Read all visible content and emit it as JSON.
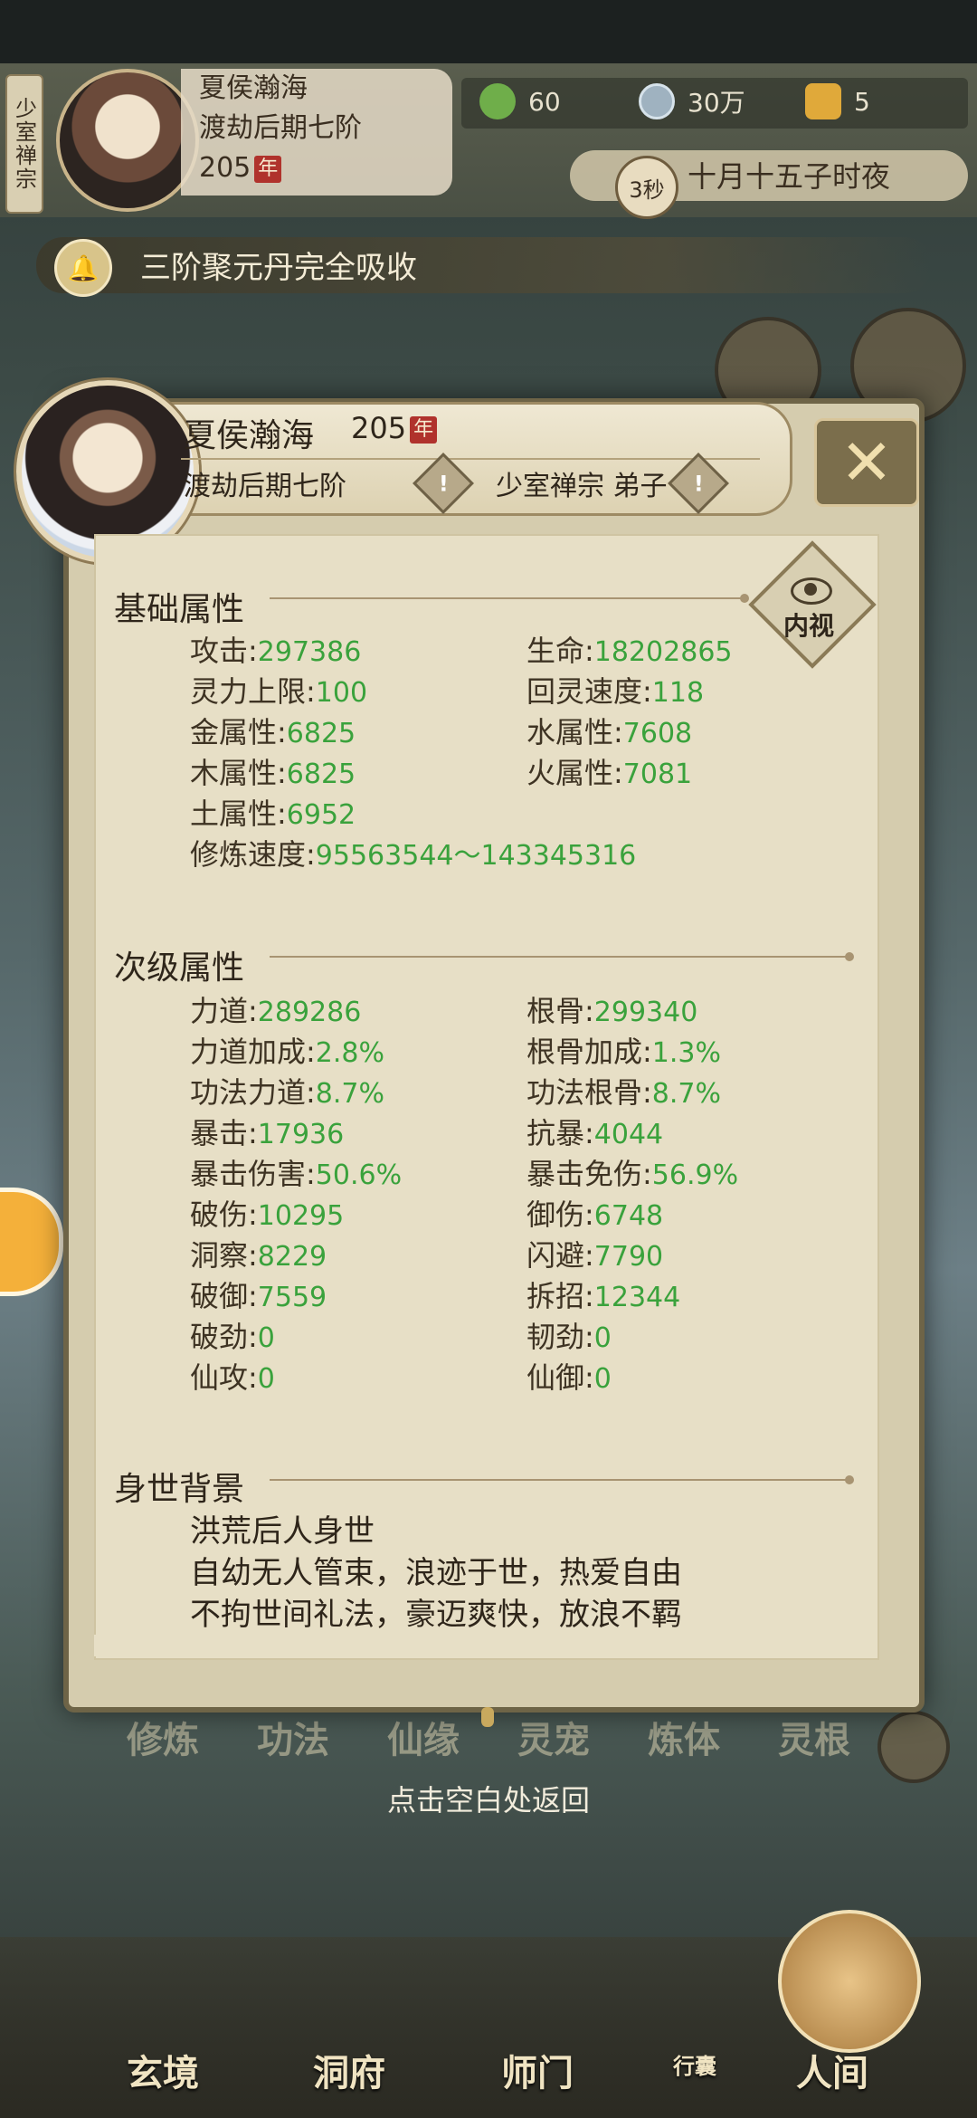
{
  "hud": {
    "sect_tag": "少室禅宗",
    "name": "夏侯瀚海",
    "realm": "渡劫后期七阶",
    "age": "205",
    "age_unit": "年",
    "resources": [
      {
        "icon": "leaf-icon",
        "value": "60"
      },
      {
        "icon": "coin-icon",
        "value": "30万"
      },
      {
        "icon": "trophy-icon",
        "value": "5"
      }
    ],
    "timer": "3秒",
    "time_text": "十月十五子时夜",
    "notice": "三阶聚元丹完全吸收"
  },
  "header": {
    "name": "夏侯瀚海",
    "age": "205",
    "age_unit": "年",
    "realm": "渡劫后期七阶",
    "sect": "少室禅宗 弟子"
  },
  "inner_view_label": "内视",
  "basic": {
    "title": "基础属性",
    "left": [
      {
        "label": "攻击",
        "value": "297386"
      },
      {
        "label": "灵力上限",
        "value": "100"
      },
      {
        "label": "金属性",
        "value": "6825"
      },
      {
        "label": "木属性",
        "value": "6825"
      },
      {
        "label": "土属性",
        "value": "6952"
      },
      {
        "label": "修炼速度",
        "value": "95563544～143345316"
      }
    ],
    "right": [
      {
        "label": "生命",
        "value": "18202865"
      },
      {
        "label": "回灵速度",
        "value": "118"
      },
      {
        "label": "水属性",
        "value": "7608"
      },
      {
        "label": "火属性",
        "value": "7081"
      }
    ]
  },
  "secondary": {
    "title": "次级属性",
    "left": [
      {
        "label": "力道",
        "value": "289286"
      },
      {
        "label": "力道加成",
        "value": "2.8%"
      },
      {
        "label": "功法力道",
        "value": "8.7%"
      },
      {
        "label": "暴击",
        "value": "17936"
      },
      {
        "label": "暴击伤害",
        "value": "50.6%"
      },
      {
        "label": "破伤",
        "value": "10295"
      },
      {
        "label": "洞察",
        "value": "8229"
      },
      {
        "label": "破御",
        "value": "7559"
      },
      {
        "label": "破劲",
        "value": "0"
      },
      {
        "label": "仙攻",
        "value": "0"
      }
    ],
    "right": [
      {
        "label": "根骨",
        "value": "299340"
      },
      {
        "label": "根骨加成",
        "value": "1.3%"
      },
      {
        "label": "功法根骨",
        "value": "8.7%"
      },
      {
        "label": "抗暴",
        "value": "4044"
      },
      {
        "label": "暴击免伤",
        "value": "56.9%"
      },
      {
        "label": "御伤",
        "value": "6748"
      },
      {
        "label": "闪避",
        "value": "7790"
      },
      {
        "label": "拆招",
        "value": "12344"
      },
      {
        "label": "韧劲",
        "value": "0"
      },
      {
        "label": "仙御",
        "value": "0"
      }
    ]
  },
  "background": {
    "title": "身世背景",
    "lines": [
      "洪荒后人身世",
      "自幼无人管束，浪迹于世，热爱自由",
      "不拘世间礼法，豪迈爽快，放浪不羁"
    ]
  },
  "bg_menu": [
    "修炼",
    "功法",
    "仙缘",
    "灵宠",
    "炼体",
    "灵根"
  ],
  "tap_hint": "点击空白处返回",
  "bottom_nav": [
    "玄境",
    "洞府",
    "师门",
    "行囊",
    "人间"
  ]
}
